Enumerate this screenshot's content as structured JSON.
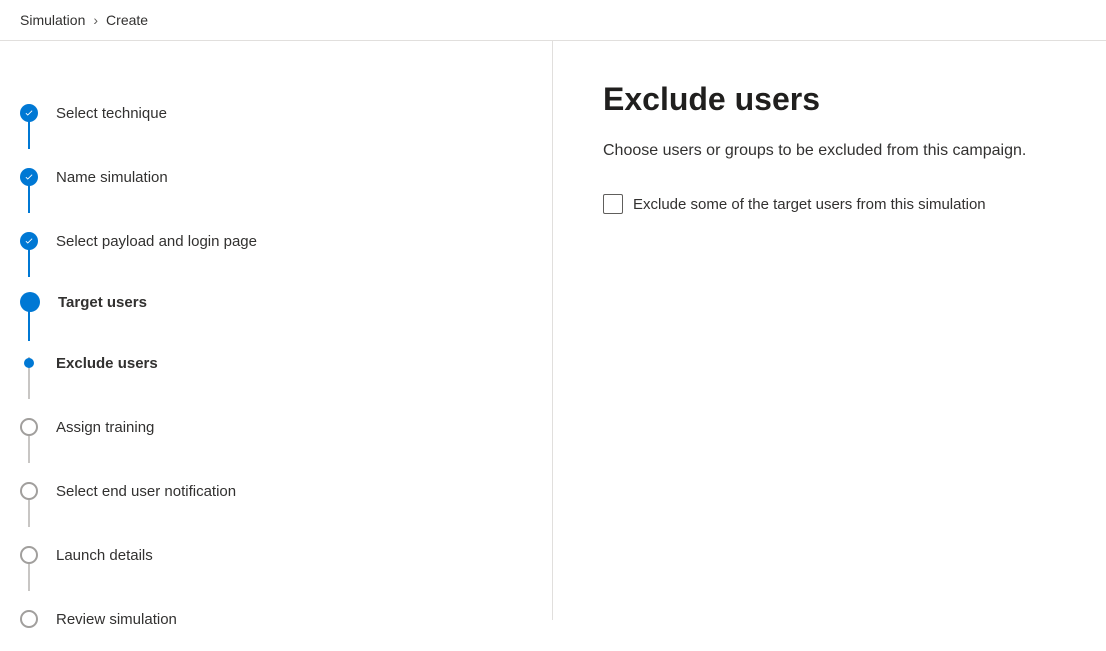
{
  "breadcrumb": {
    "items": [
      "Simulation",
      "Create"
    ]
  },
  "steps": [
    {
      "label": "Select technique",
      "state": "completed"
    },
    {
      "label": "Name simulation",
      "state": "completed"
    },
    {
      "label": "Select payload and login page",
      "state": "completed"
    },
    {
      "label": "Target users",
      "state": "current"
    },
    {
      "label": "Exclude users",
      "state": "active-sub"
    },
    {
      "label": "Assign training",
      "state": "pending"
    },
    {
      "label": "Select end user notification",
      "state": "pending"
    },
    {
      "label": "Launch details",
      "state": "pending"
    },
    {
      "label": "Review simulation",
      "state": "pending"
    }
  ],
  "main": {
    "title": "Exclude users",
    "description": "Choose users or groups to be excluded from this campaign.",
    "checkbox_label": "Exclude some of the target users from this simulation"
  }
}
